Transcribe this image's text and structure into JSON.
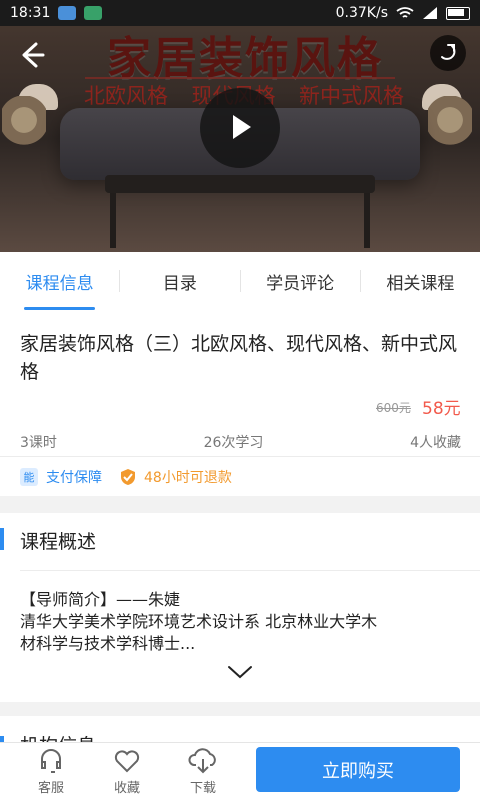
{
  "status_bar": {
    "time": "18:31",
    "network_speed": "0.37K/s",
    "icons": [
      "usb-icon",
      "android-icon",
      "wifi-icon",
      "signal-icon",
      "battery-icon"
    ]
  },
  "hero": {
    "title": "家居装饰风格",
    "subtitle_items": [
      "北欧风格",
      "现代风格",
      "新中式风格"
    ],
    "icons": [
      "back-arrow-icon",
      "share-icon",
      "play-icon"
    ]
  },
  "tabs": [
    "课程信息",
    "目录",
    "学员评论",
    "相关课程"
  ],
  "course": {
    "title": "家居装饰风格（三）北欧风格、现代风格、新中式风格",
    "old_price": "600元",
    "new_price": "58元",
    "stats": [
      "3课时",
      "26次学习",
      "4人收藏"
    ],
    "guarantees": {
      "pay_badge": "能",
      "pay": "支付保障",
      "refund": "48小时可退款"
    }
  },
  "overview": {
    "section_title": "课程概述",
    "text_lines": [
      "【导师简介】——朱婕",
      "清华大学美术学院环境艺术设计系 北京林业大学木",
      "材科学与技术学科博士..."
    ]
  },
  "next_section": {
    "title": "机构信息"
  },
  "bottom_bar": {
    "service": "客服",
    "collect": "收藏",
    "download": "下载",
    "buy": "立即购买"
  },
  "colors": {
    "accent": "#2d8cf0",
    "price": "#f25a4c",
    "refund": "#f29a2e"
  }
}
